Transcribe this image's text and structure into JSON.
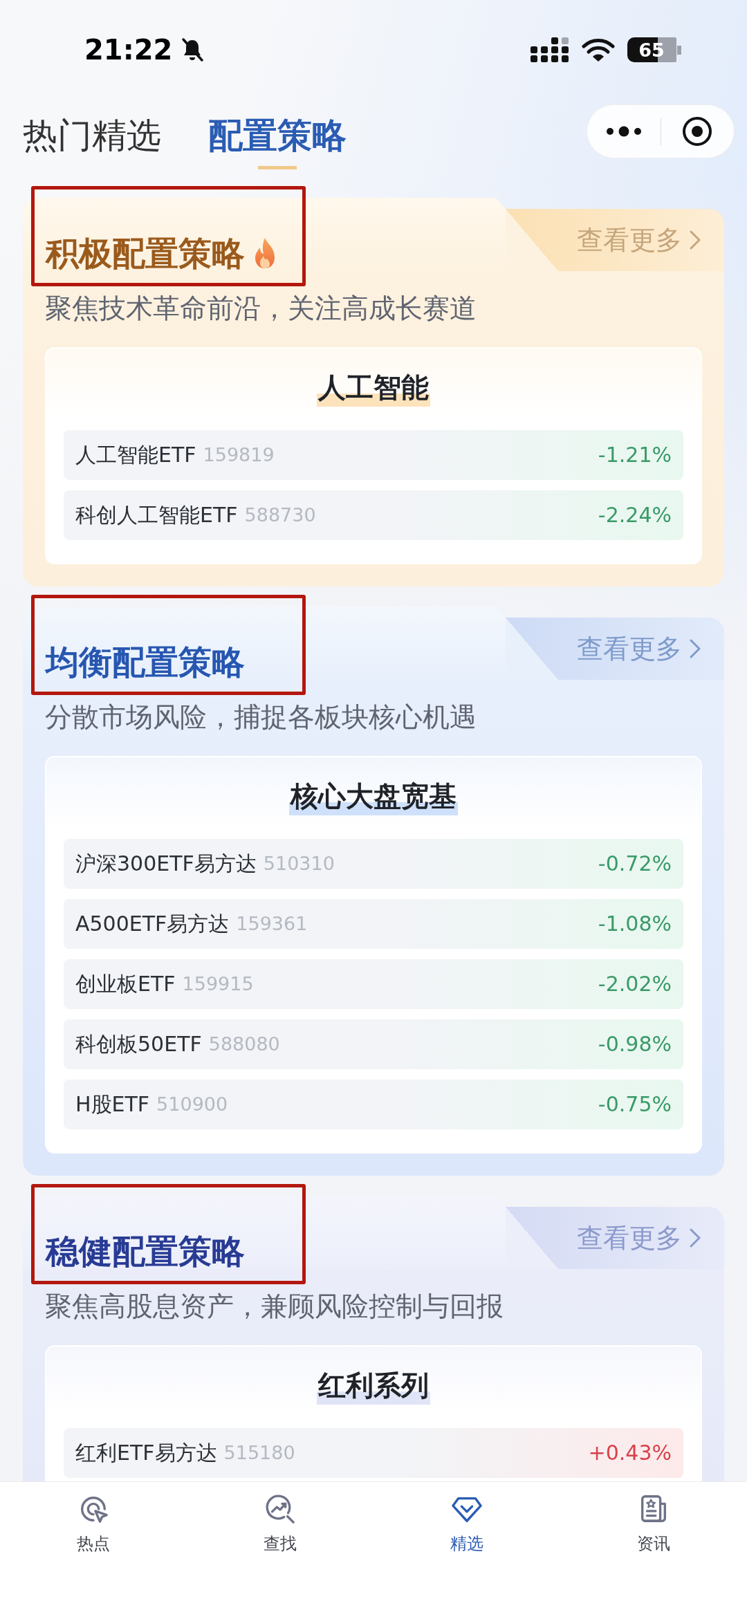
{
  "status_bar": {
    "time": "21:22",
    "battery": "65"
  },
  "tabs": [
    {
      "label": "热门精选",
      "selected": false
    },
    {
      "label": "配置策略",
      "selected": true
    }
  ],
  "strategies": [
    {
      "kind": "aggressive",
      "title": "积极配置策略",
      "hot": true,
      "marked": true,
      "more": "查看更多",
      "subtitle": "聚焦技术革命前沿，关注高成长赛道",
      "section": {
        "title": "人工智能",
        "funds": [
          {
            "name": "人工智能ETF",
            "code": "159819",
            "change": "-1.21%",
            "rising": false
          },
          {
            "name": "科创人工智能ETF",
            "code": "588730",
            "change": "-2.24%",
            "rising": false
          }
        ]
      }
    },
    {
      "kind": "balanced",
      "title": "均衡配置策略",
      "hot": false,
      "marked": true,
      "more": "查看更多",
      "subtitle": "分散市场风险，捕捉各板块核心机遇",
      "section": {
        "title": "核心大盘宽基",
        "funds": [
          {
            "name": "沪深300ETF易方达",
            "code": "510310",
            "change": "-0.72%",
            "rising": false
          },
          {
            "name": "A500ETF易方达",
            "code": "159361",
            "change": "-1.08%",
            "rising": false
          },
          {
            "name": "创业板ETF",
            "code": "159915",
            "change": "-2.02%",
            "rising": false
          },
          {
            "name": "科创板50ETF",
            "code": "588080",
            "change": "-0.98%",
            "rising": false
          },
          {
            "name": "H股ETF",
            "code": "510900",
            "change": "-0.75%",
            "rising": false
          }
        ]
      }
    },
    {
      "kind": "steady",
      "title": "稳健配置策略",
      "hot": false,
      "marked": true,
      "more": "查看更多",
      "subtitle": "聚焦高股息资产，兼顾风险控制与回报",
      "section": {
        "title": "红利系列",
        "funds": [
          {
            "name": "红利ETF易方达",
            "code": "515180",
            "change": "+0.43%",
            "rising": true
          }
        ]
      }
    }
  ],
  "bottom_nav": [
    {
      "label": "热点",
      "selected": false
    },
    {
      "label": "查找",
      "selected": false
    },
    {
      "label": "精选",
      "selected": true
    },
    {
      "label": "资讯",
      "selected": false
    }
  ]
}
